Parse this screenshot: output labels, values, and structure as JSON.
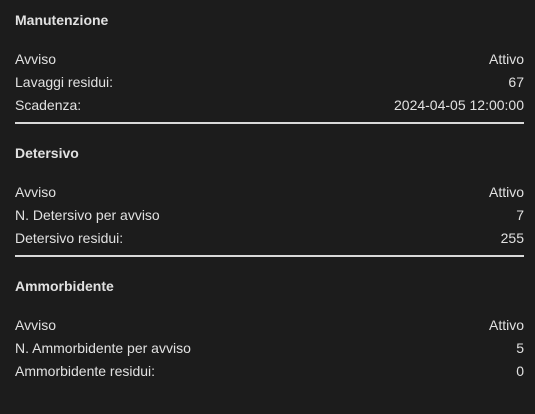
{
  "sections": [
    {
      "title": "Manutenzione",
      "rows": [
        {
          "label": "Avviso",
          "value": "Attivo"
        },
        {
          "label": "Lavaggi residui:",
          "value": "67"
        },
        {
          "label": "Scadenza:",
          "value": "2024-04-05 12:00:00"
        }
      ]
    },
    {
      "title": "Detersivo",
      "rows": [
        {
          "label": "Avviso",
          "value": "Attivo"
        },
        {
          "label": "N. Detersivo per avviso",
          "value": "7"
        },
        {
          "label": "Detersivo residui:",
          "value": "255"
        }
      ]
    },
    {
      "title": "Ammorbidente",
      "rows": [
        {
          "label": "Avviso",
          "value": "Attivo"
        },
        {
          "label": "N. Ammorbidente per avviso",
          "value": "5"
        },
        {
          "label": "Ammorbidente residui:",
          "value": "0"
        }
      ]
    }
  ]
}
